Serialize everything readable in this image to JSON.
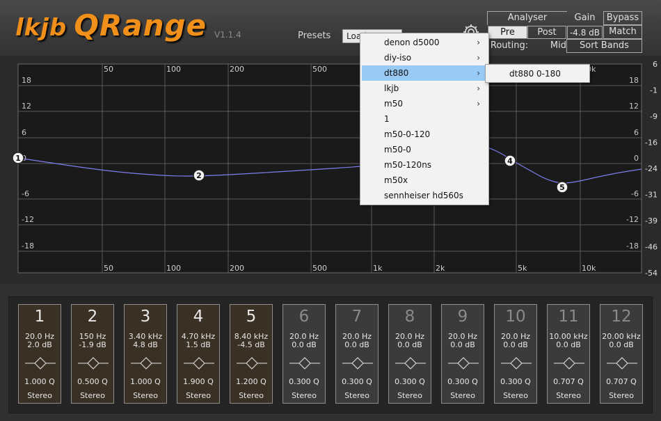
{
  "app": {
    "logo_part1": "lkjb",
    "logo_part2": "QRange",
    "version": "V1.1.4"
  },
  "presets": {
    "label": "Presets",
    "load_label": "Load"
  },
  "controls": {
    "analyser": "Analyser",
    "pre": "Pre",
    "post": "Post",
    "gain_label": "Gain",
    "gain_value": "-4.8 dB",
    "bypass": "Bypass",
    "match": "Match",
    "routing_label": "Routing:",
    "routing_value": "Mid",
    "sort_bands": "Sort Bands"
  },
  "graph": {
    "freq_labels": [
      "50",
      "100",
      "200",
      "500",
      "1k",
      "2k",
      "5k",
      "10k"
    ],
    "db_labels_left": [
      "18",
      "12",
      "6",
      "0",
      "-6",
      "-12",
      "-18"
    ],
    "db_labels_right": [
      "18",
      "12",
      "6",
      "0",
      "-6",
      "-12",
      "-18"
    ],
    "analyser_scale": [
      "6",
      "-1",
      "-9",
      "-16",
      "-24",
      "-31",
      "-39",
      "-46",
      "-54"
    ],
    "curve_color": "#7e7ef0",
    "nodes": [
      {
        "label": "1"
      },
      {
        "label": "2"
      },
      {
        "label": "4"
      },
      {
        "label": "5"
      }
    ]
  },
  "preset_menu": {
    "items": [
      {
        "label": "denon d5000",
        "submenu": true
      },
      {
        "label": "diy-iso",
        "submenu": true
      },
      {
        "label": "dt880",
        "submenu": true,
        "selected": true
      },
      {
        "label": "lkjb",
        "submenu": true
      },
      {
        "label": "m50",
        "submenu": true
      },
      {
        "label": "1",
        "submenu": false
      },
      {
        "label": "m50-0-120",
        "submenu": false
      },
      {
        "label": "m50-0",
        "submenu": false
      },
      {
        "label": "m50-120ns",
        "submenu": false
      },
      {
        "label": "m50x",
        "submenu": false
      },
      {
        "label": "sennheiser hd560s",
        "submenu": false
      }
    ],
    "submenu_items": [
      {
        "label": "dt880 0-180"
      }
    ]
  },
  "bands": [
    {
      "num": "1",
      "freq": "20.0 Hz",
      "gain": "2.0 dB",
      "q": "1.000 Q",
      "mode": "Stereo",
      "active": true
    },
    {
      "num": "2",
      "freq": "150 Hz",
      "gain": "-1.9 dB",
      "q": "0.500 Q",
      "mode": "Stereo",
      "active": true
    },
    {
      "num": "3",
      "freq": "3.40 kHz",
      "gain": "4.8 dB",
      "q": "1.000 Q",
      "mode": "Stereo",
      "active": true
    },
    {
      "num": "4",
      "freq": "4.70 kHz",
      "gain": "1.5 dB",
      "q": "1.900 Q",
      "mode": "Stereo",
      "active": true
    },
    {
      "num": "5",
      "freq": "8.40 kHz",
      "gain": "-4.5 dB",
      "q": "1.200 Q",
      "mode": "Stereo",
      "active": true
    },
    {
      "num": "6",
      "freq": "20.0 Hz",
      "gain": "0.0 dB",
      "q": "0.300 Q",
      "mode": "Stereo",
      "active": false
    },
    {
      "num": "7",
      "freq": "20.0 Hz",
      "gain": "0.0 dB",
      "q": "0.300 Q",
      "mode": "Stereo",
      "active": false
    },
    {
      "num": "8",
      "freq": "20.0 Hz",
      "gain": "0.0 dB",
      "q": "0.300 Q",
      "mode": "Stereo",
      "active": false
    },
    {
      "num": "9",
      "freq": "20.0 Hz",
      "gain": "0.0 dB",
      "q": "0.300 Q",
      "mode": "Stereo",
      "active": false
    },
    {
      "num": "10",
      "freq": "20.0 Hz",
      "gain": "0.0 dB",
      "q": "0.300 Q",
      "mode": "Stereo",
      "active": false
    },
    {
      "num": "11",
      "freq": "10.00 kHz",
      "gain": "0.0 dB",
      "q": "0.707 Q",
      "mode": "Stereo",
      "active": false
    },
    {
      "num": "12",
      "freq": "20.00 kHz",
      "gain": "0.0 dB",
      "q": "0.707 Q",
      "mode": "Stereo",
      "active": false
    }
  ],
  "colors": {
    "accent": "#f0901a",
    "menu_highlight": "#99c9f5"
  }
}
